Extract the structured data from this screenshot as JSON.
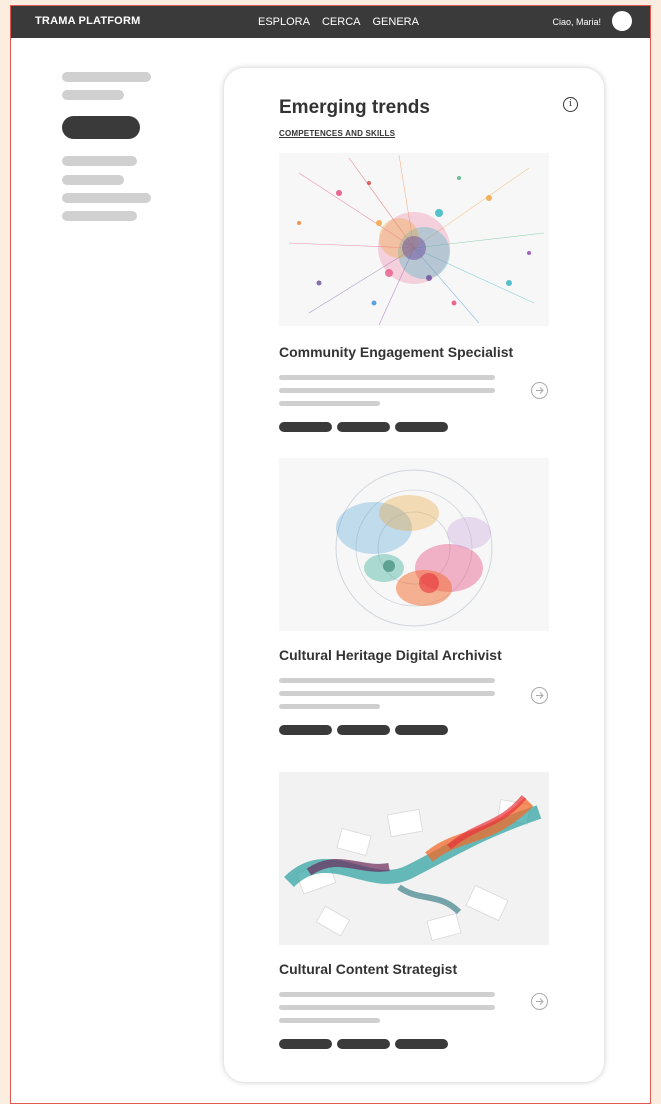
{
  "header": {
    "brand": "TRAMA PLATFORM",
    "nav": [
      "ESPLORA",
      "CERCA",
      "GENERA"
    ],
    "greeting": "Ciao, Maria!"
  },
  "card": {
    "title": "Emerging trends",
    "subtitle": "COMPETENCES AND SKILLS",
    "items": [
      {
        "title": "Community Engagement Specialist",
        "image": "colorful-particle-network-image"
      },
      {
        "title": "Cultural Heritage Digital Archivist",
        "image": "colorful-circular-swirl-image"
      },
      {
        "title": "Cultural Content Strategist",
        "image": "colorful-paper-ribbon-image"
      }
    ]
  },
  "colors": {
    "accent_border": "#e05a4f",
    "dark": "#3a3a3a",
    "placeholder": "#d0d0d0",
    "background": "#fbeee0"
  }
}
